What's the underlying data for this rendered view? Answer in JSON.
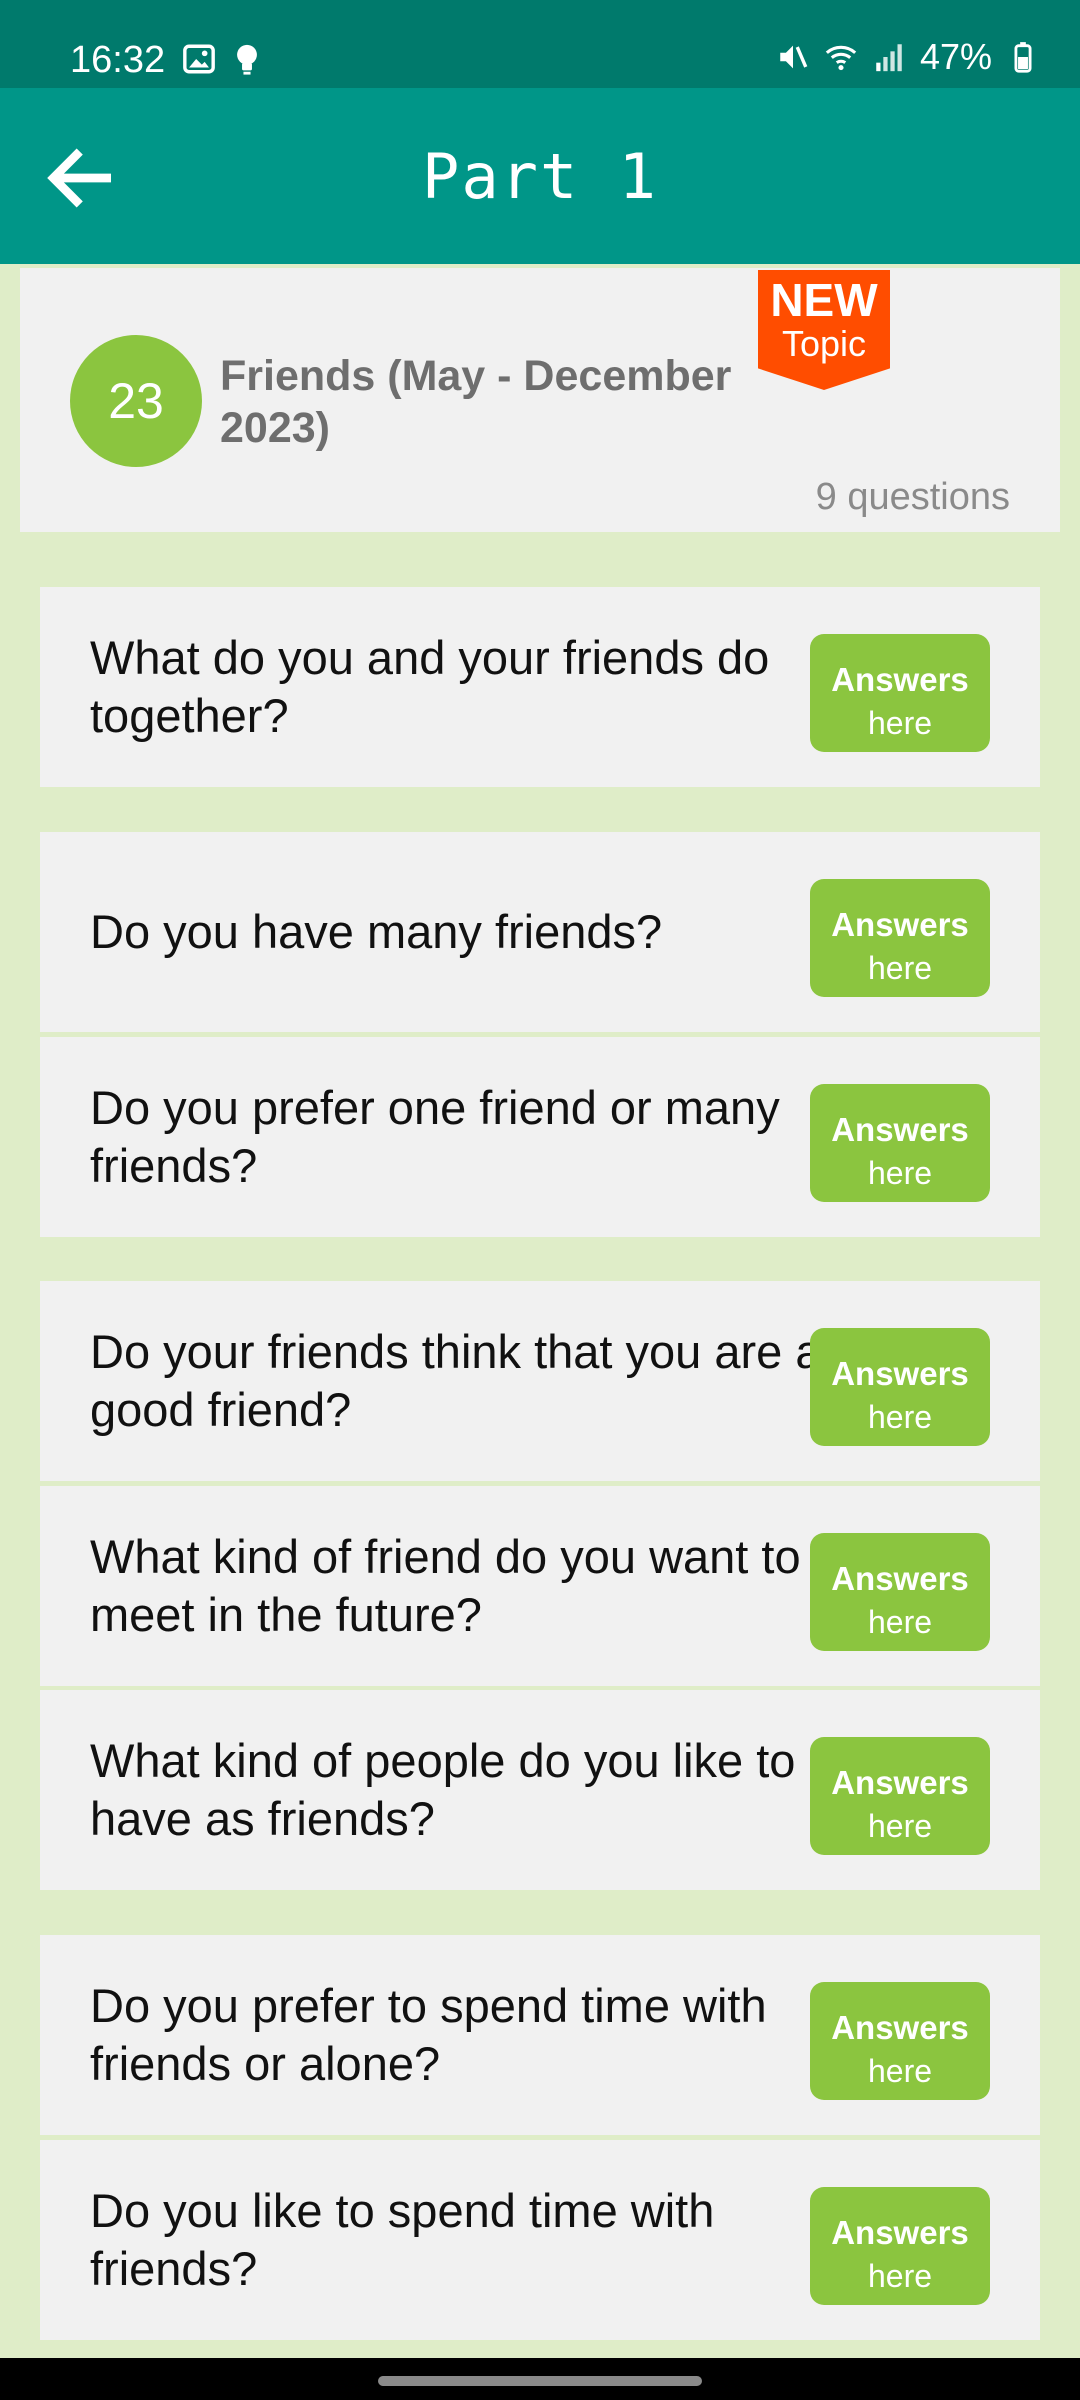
{
  "status_bar": {
    "time": "16:32",
    "battery": "47%",
    "icons": [
      "image-icon",
      "bulb-icon",
      "mute-icon",
      "wifi-icon",
      "signal-icon",
      "battery-icon"
    ]
  },
  "app_bar": {
    "title": "Part 1",
    "back_icon": "arrow-left-icon"
  },
  "topic": {
    "number": "23",
    "title": "Friends (May - December 2023)",
    "count": "9 questions",
    "badge_top": "NEW",
    "badge_bottom": "Topic"
  },
  "colors": {
    "status_bar": "#007a6c",
    "app_bar": "#009688",
    "accent_green": "#8bc53f",
    "badge_orange": "#ff4d00",
    "background": "#dfedc8"
  },
  "questions": [
    {
      "text": "What do you and your friends do together?",
      "button_top": "Answers",
      "button_bottom": "here"
    },
    {
      "text": "Do you have many friends?",
      "button_top": "Answers",
      "button_bottom": "here"
    },
    {
      "text": "Do you prefer one friend or many friends?",
      "button_top": "Answers",
      "button_bottom": "here"
    },
    {
      "text": "Do your friends think that you are a good friend?",
      "button_top": "Answers",
      "button_bottom": "here"
    },
    {
      "text": "What kind of friend do you want to meet in the future?",
      "button_top": "Answers",
      "button_bottom": "here"
    },
    {
      "text": "What kind of people do you like to have as friends?",
      "button_top": "Answers",
      "button_bottom": "here"
    },
    {
      "text": "Do you prefer to spend time with friends or alone?",
      "button_top": "Answers",
      "button_bottom": "here"
    },
    {
      "text": "Do you like to spend time with friends?",
      "button_top": "Answers",
      "button_bottom": "here"
    }
  ]
}
